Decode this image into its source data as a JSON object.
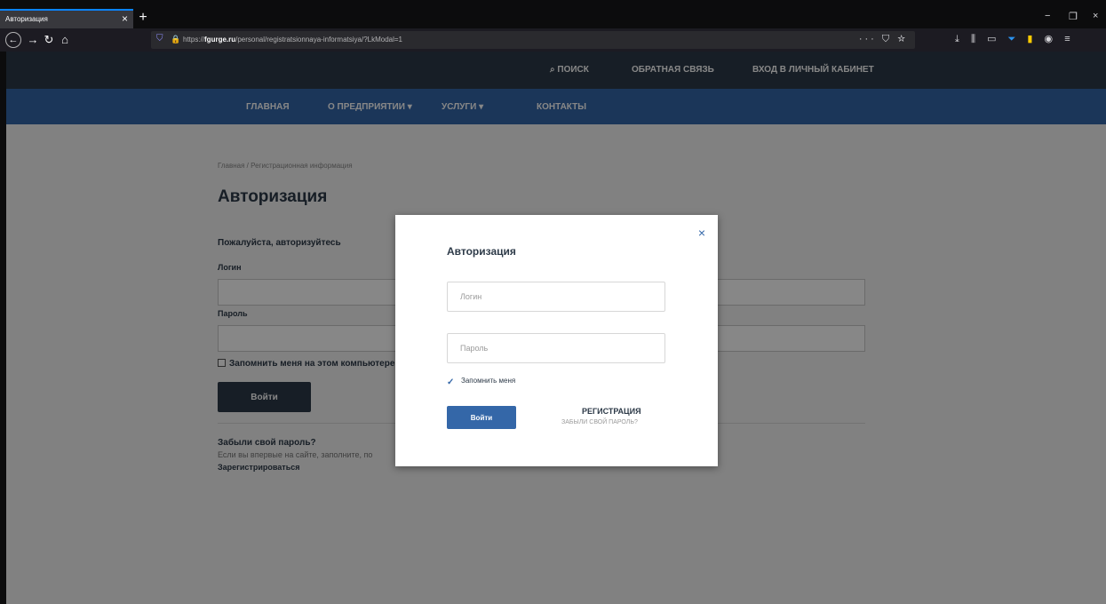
{
  "browser": {
    "tab_title": "Авторизация",
    "tab_close": "×",
    "new_tab": "+",
    "win_min": "−",
    "win_restore": "❐",
    "win_close": "×",
    "url_prefix": "https://",
    "url_host": "fgurge.ru",
    "url_path": "/personal/registratsionnaya-informatsiya/?LkModal=1",
    "url_actions": "··· ⛉ ☆",
    "icons": [
      "back-icon",
      "forward-icon",
      "reload-icon",
      "home-icon",
      "shield-icon",
      "lock-icon",
      "download-icon",
      "library-icon",
      "sidebar-icon",
      "pocket-icon",
      "extension-icon",
      "account-icon",
      "menu-icon"
    ]
  },
  "topbar": {
    "search": "Поиск",
    "feedback": "Обратная связь",
    "cabinet": "Вход в личный кабинет"
  },
  "mainnav": {
    "items": [
      {
        "label": "Главная"
      },
      {
        "label": "О предприятии ▾"
      },
      {
        "label": "Услуги ▾"
      },
      {
        "label": "Контакты"
      }
    ]
  },
  "page": {
    "breadcrumb": "Главная / Регистрационная информация",
    "title": "Авторизация",
    "subtitle": "Пожалуйста, авторизуйтесь",
    "login_label": "Логин",
    "password_label": "Пароль",
    "remember_label": "Запомнить меня на этом компьютере",
    "login_button": "Войти",
    "forgot_title": "Забыли свой пароль?",
    "forgot_text": "Если вы впервые на сайте, заполните, по",
    "register_link": "Зарегистрироваться"
  },
  "modal": {
    "close": "×",
    "title": "Авторизация",
    "login_placeholder": "Логин",
    "password_placeholder": "Пароль",
    "remember_checked": true,
    "remember_label": "Запомнить меня",
    "login_button": "Войти",
    "register": "Регистрация",
    "forgot": "Забыли свой пароль?"
  },
  "colors": {
    "topbar": "#2d3a48",
    "mainnav": "#3467a8",
    "accent": "#3467a8",
    "text_dark": "#2d3a48"
  }
}
